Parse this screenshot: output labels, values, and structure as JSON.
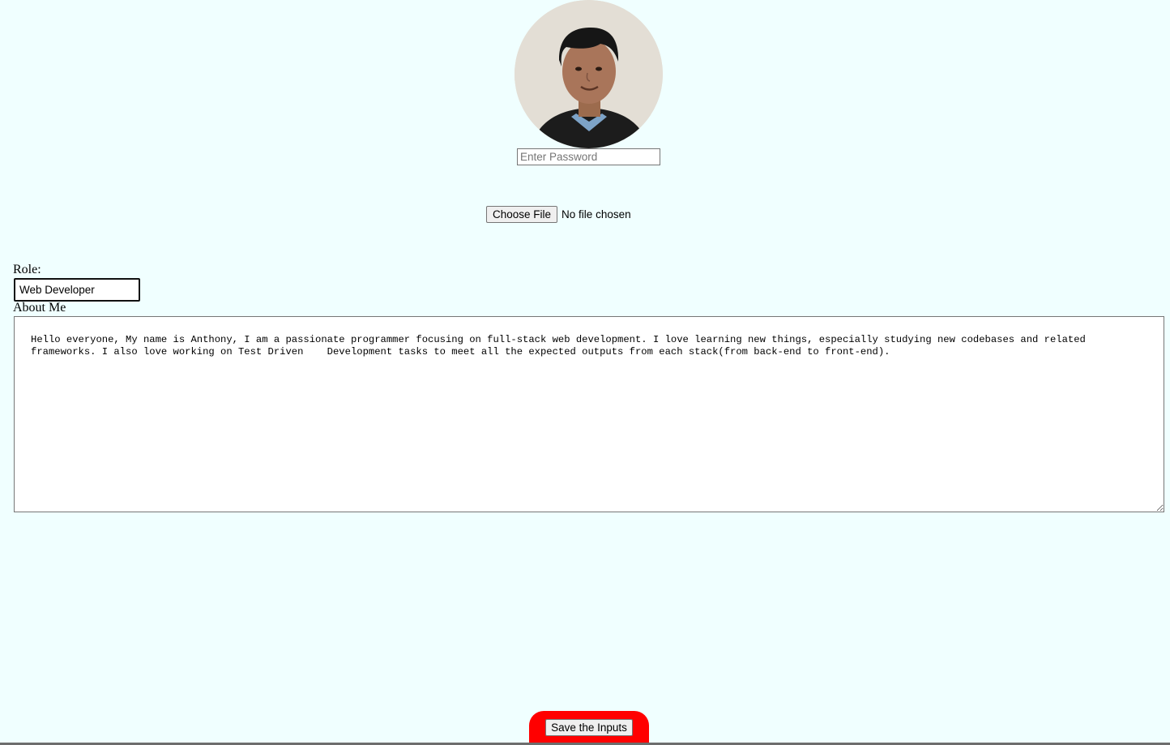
{
  "profile": {
    "avatar": "profile-photo"
  },
  "password": {
    "placeholder": "Enter Password",
    "value": ""
  },
  "file_upload": {
    "button_label": "Choose File",
    "status": "No file chosen"
  },
  "role": {
    "label": "Role:",
    "value": "Web Developer"
  },
  "about": {
    "label": "About Me",
    "value": "Hello everyone, My name is Anthony, I am a passionate programmer focusing on full-stack web development. I love learning new things, especially studying new codebases and related frameworks. I also love working on Test Driven    Development tasks to meet all the expected outputs from each stack(from back-end to front-end)."
  },
  "save": {
    "label": "Save the Inputs"
  },
  "colors": {
    "background": "#f0ffff",
    "save_accent": "#ff0000"
  }
}
